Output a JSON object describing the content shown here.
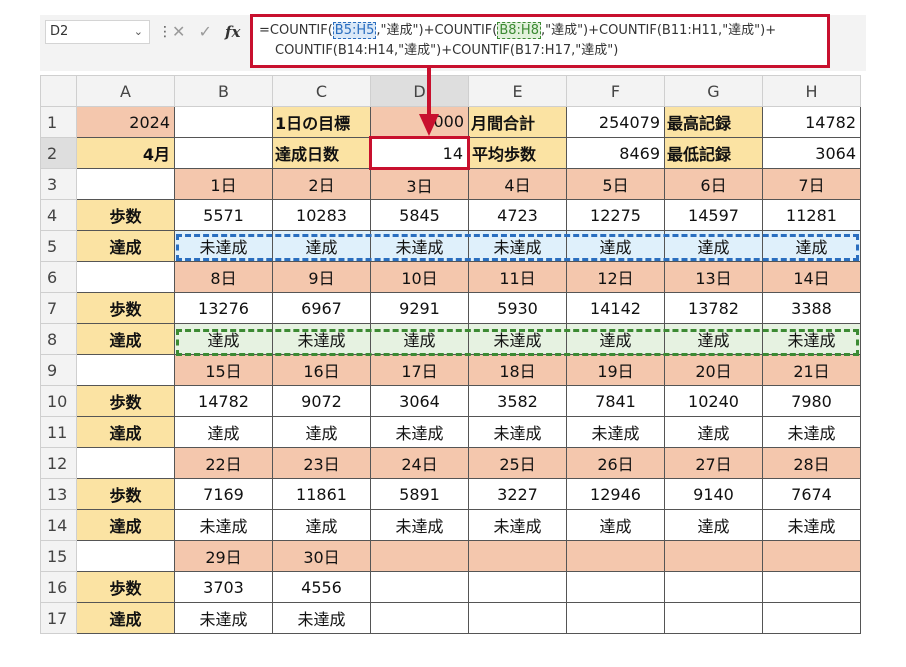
{
  "name_box": "D2",
  "formula": {
    "line1_prefix": "=COUNTIF(",
    "ref1": "B5:H5",
    "line1_mid": ",\"達成\")+COUNTIF(",
    "ref2": "B8:H8",
    "line1_suffix": ",\"達成\")+COUNTIF(B11:H11,\"達成\")+",
    "line2": "COUNTIF(B14:H14,\"達成\")+COUNTIF(B17:H17,\"達成\")"
  },
  "columns": [
    "A",
    "B",
    "C",
    "D",
    "E",
    "F",
    "G",
    "H"
  ],
  "rows": [
    [
      "2024",
      "",
      "1日の目標",
      "8000",
      "月間合計",
      "254079",
      "最高記録",
      "14782"
    ],
    [
      "4月",
      "",
      "達成日数",
      "14",
      "平均歩数",
      "8469",
      "最低記録",
      "3064"
    ],
    [
      "",
      "1日",
      "2日",
      "3日",
      "4日",
      "5日",
      "6日",
      "7日"
    ],
    [
      "歩数",
      "5571",
      "10283",
      "5845",
      "4723",
      "12275",
      "14597",
      "11281"
    ],
    [
      "達成",
      "未達成",
      "達成",
      "未達成",
      "未達成",
      "達成",
      "達成",
      "達成"
    ],
    [
      "",
      "8日",
      "9日",
      "10日",
      "11日",
      "12日",
      "13日",
      "14日"
    ],
    [
      "歩数",
      "13276",
      "6967",
      "9291",
      "5930",
      "14142",
      "13782",
      "3388"
    ],
    [
      "達成",
      "達成",
      "未達成",
      "達成",
      "未達成",
      "達成",
      "達成",
      "未達成"
    ],
    [
      "",
      "15日",
      "16日",
      "17日",
      "18日",
      "19日",
      "20日",
      "21日"
    ],
    [
      "歩数",
      "14782",
      "9072",
      "3064",
      "3582",
      "7841",
      "10240",
      "7980"
    ],
    [
      "達成",
      "達成",
      "達成",
      "未達成",
      "未達成",
      "未達成",
      "達成",
      "未達成"
    ],
    [
      "",
      "22日",
      "23日",
      "24日",
      "25日",
      "26日",
      "27日",
      "28日"
    ],
    [
      "歩数",
      "7169",
      "11861",
      "5891",
      "3227",
      "12946",
      "9140",
      "7674"
    ],
    [
      "達成",
      "未達成",
      "達成",
      "未達成",
      "未達成",
      "達成",
      "達成",
      "未達成"
    ],
    [
      "",
      "29日",
      "30日",
      "",
      "",
      "",
      "",
      ""
    ],
    [
      "歩数",
      "3703",
      "4556",
      "",
      "",
      "",
      "",
      ""
    ],
    [
      "達成",
      "未達成",
      "未達成",
      "",
      "",
      "",
      "",
      ""
    ]
  ],
  "colors": {
    "highlight_red": "#c8102e",
    "range_blue": "#2a6ebf",
    "range_green": "#3c8a33",
    "fill_orange": "#f4c7ad",
    "fill_yellow": "#fbe3a3"
  }
}
